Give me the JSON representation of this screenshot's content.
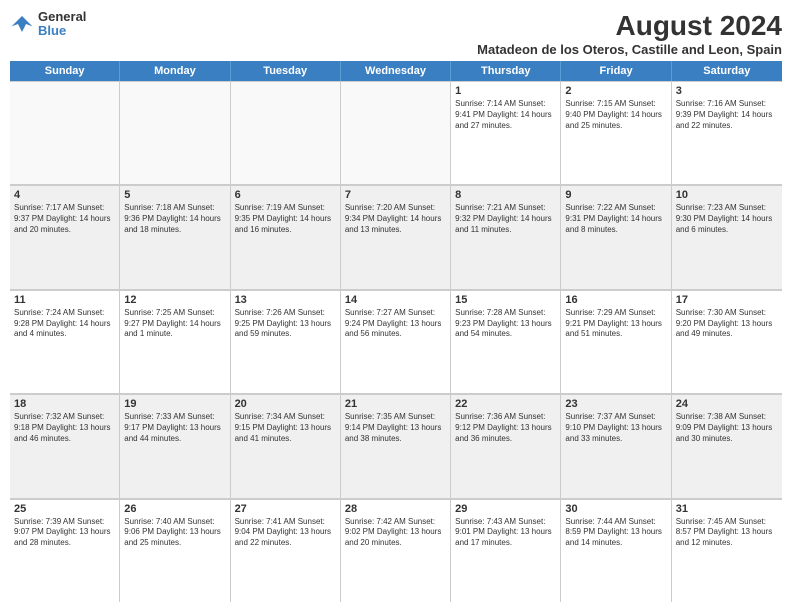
{
  "logo": {
    "line1": "General",
    "line2": "Blue"
  },
  "title": "August 2024",
  "subtitle": "Matadeon de los Oteros, Castille and Leon, Spain",
  "days": [
    "Sunday",
    "Monday",
    "Tuesday",
    "Wednesday",
    "Thursday",
    "Friday",
    "Saturday"
  ],
  "weeks": [
    [
      {
        "day": "",
        "info": ""
      },
      {
        "day": "",
        "info": ""
      },
      {
        "day": "",
        "info": ""
      },
      {
        "day": "",
        "info": ""
      },
      {
        "day": "1",
        "info": "Sunrise: 7:14 AM\nSunset: 9:41 PM\nDaylight: 14 hours\nand 27 minutes."
      },
      {
        "day": "2",
        "info": "Sunrise: 7:15 AM\nSunset: 9:40 PM\nDaylight: 14 hours\nand 25 minutes."
      },
      {
        "day": "3",
        "info": "Sunrise: 7:16 AM\nSunset: 9:39 PM\nDaylight: 14 hours\nand 22 minutes."
      }
    ],
    [
      {
        "day": "4",
        "info": "Sunrise: 7:17 AM\nSunset: 9:37 PM\nDaylight: 14 hours\nand 20 minutes."
      },
      {
        "day": "5",
        "info": "Sunrise: 7:18 AM\nSunset: 9:36 PM\nDaylight: 14 hours\nand 18 minutes."
      },
      {
        "day": "6",
        "info": "Sunrise: 7:19 AM\nSunset: 9:35 PM\nDaylight: 14 hours\nand 16 minutes."
      },
      {
        "day": "7",
        "info": "Sunrise: 7:20 AM\nSunset: 9:34 PM\nDaylight: 14 hours\nand 13 minutes."
      },
      {
        "day": "8",
        "info": "Sunrise: 7:21 AM\nSunset: 9:32 PM\nDaylight: 14 hours\nand 11 minutes."
      },
      {
        "day": "9",
        "info": "Sunrise: 7:22 AM\nSunset: 9:31 PM\nDaylight: 14 hours\nand 8 minutes."
      },
      {
        "day": "10",
        "info": "Sunrise: 7:23 AM\nSunset: 9:30 PM\nDaylight: 14 hours\nand 6 minutes."
      }
    ],
    [
      {
        "day": "11",
        "info": "Sunrise: 7:24 AM\nSunset: 9:28 PM\nDaylight: 14 hours\nand 4 minutes."
      },
      {
        "day": "12",
        "info": "Sunrise: 7:25 AM\nSunset: 9:27 PM\nDaylight: 14 hours\nand 1 minute."
      },
      {
        "day": "13",
        "info": "Sunrise: 7:26 AM\nSunset: 9:25 PM\nDaylight: 13 hours\nand 59 minutes."
      },
      {
        "day": "14",
        "info": "Sunrise: 7:27 AM\nSunset: 9:24 PM\nDaylight: 13 hours\nand 56 minutes."
      },
      {
        "day": "15",
        "info": "Sunrise: 7:28 AM\nSunset: 9:23 PM\nDaylight: 13 hours\nand 54 minutes."
      },
      {
        "day": "16",
        "info": "Sunrise: 7:29 AM\nSunset: 9:21 PM\nDaylight: 13 hours\nand 51 minutes."
      },
      {
        "day": "17",
        "info": "Sunrise: 7:30 AM\nSunset: 9:20 PM\nDaylight: 13 hours\nand 49 minutes."
      }
    ],
    [
      {
        "day": "18",
        "info": "Sunrise: 7:32 AM\nSunset: 9:18 PM\nDaylight: 13 hours\nand 46 minutes."
      },
      {
        "day": "19",
        "info": "Sunrise: 7:33 AM\nSunset: 9:17 PM\nDaylight: 13 hours\nand 44 minutes."
      },
      {
        "day": "20",
        "info": "Sunrise: 7:34 AM\nSunset: 9:15 PM\nDaylight: 13 hours\nand 41 minutes."
      },
      {
        "day": "21",
        "info": "Sunrise: 7:35 AM\nSunset: 9:14 PM\nDaylight: 13 hours\nand 38 minutes."
      },
      {
        "day": "22",
        "info": "Sunrise: 7:36 AM\nSunset: 9:12 PM\nDaylight: 13 hours\nand 36 minutes."
      },
      {
        "day": "23",
        "info": "Sunrise: 7:37 AM\nSunset: 9:10 PM\nDaylight: 13 hours\nand 33 minutes."
      },
      {
        "day": "24",
        "info": "Sunrise: 7:38 AM\nSunset: 9:09 PM\nDaylight: 13 hours\nand 30 minutes."
      }
    ],
    [
      {
        "day": "25",
        "info": "Sunrise: 7:39 AM\nSunset: 9:07 PM\nDaylight: 13 hours\nand 28 minutes."
      },
      {
        "day": "26",
        "info": "Sunrise: 7:40 AM\nSunset: 9:06 PM\nDaylight: 13 hours\nand 25 minutes."
      },
      {
        "day": "27",
        "info": "Sunrise: 7:41 AM\nSunset: 9:04 PM\nDaylight: 13 hours\nand 22 minutes."
      },
      {
        "day": "28",
        "info": "Sunrise: 7:42 AM\nSunset: 9:02 PM\nDaylight: 13 hours\nand 20 minutes."
      },
      {
        "day": "29",
        "info": "Sunrise: 7:43 AM\nSunset: 9:01 PM\nDaylight: 13 hours\nand 17 minutes."
      },
      {
        "day": "30",
        "info": "Sunrise: 7:44 AM\nSunset: 8:59 PM\nDaylight: 13 hours\nand 14 minutes."
      },
      {
        "day": "31",
        "info": "Sunrise: 7:45 AM\nSunset: 8:57 PM\nDaylight: 13 hours\nand 12 minutes."
      }
    ]
  ]
}
